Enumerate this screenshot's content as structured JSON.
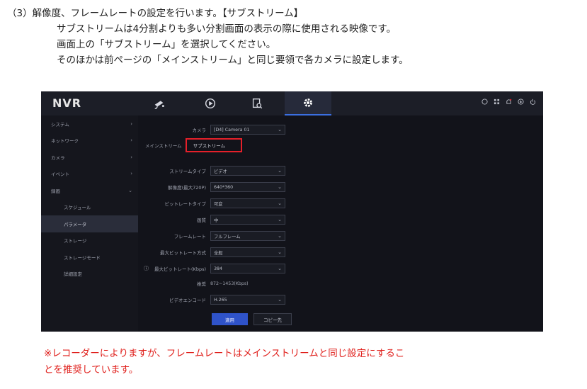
{
  "instructions": {
    "line1": "（3）解像度、フレームレートの設定を行います。【サブストリーム】",
    "line2": "サブストリームは4分割よりも多い分割画面の表示の際に使用される映像です。",
    "line3": "画面上の「サブストリーム」を選択してください。",
    "line4": "そのほかは前ページの「メインストリーム」と同じ要領で各カメラに設定します。"
  },
  "note": {
    "line1": "※レコーダーによりますが、フレームレートはメインストリームと同じ設定にするこ",
    "line2": "とを推奨しています。"
  },
  "nvr": {
    "logo": "NVR",
    "nav_icons": [
      "camera-icon",
      "playback-icon",
      "search-file-icon",
      "gear-icon"
    ],
    "status_icons": [
      "record-status-icon",
      "grid-icon",
      "alarm-icon",
      "download-icon",
      "power-icon"
    ],
    "sidebar": [
      {
        "label": "システム",
        "chevron": "›"
      },
      {
        "label": "ネットワーク",
        "chevron": "›"
      },
      {
        "label": "カメラ",
        "chevron": "›"
      },
      {
        "label": "イベント",
        "chevron": "›"
      },
      {
        "label": "録画",
        "chevron": "⌄"
      },
      {
        "label": "スケジュール",
        "chevron": ""
      },
      {
        "label": "パラメータ",
        "chevron": ""
      },
      {
        "label": "ストレージ",
        "chevron": ""
      },
      {
        "label": "ストレージモード",
        "chevron": ""
      },
      {
        "label": "詳細設定",
        "chevron": ""
      }
    ],
    "camera_label": "カメラ",
    "camera_value": "[D4] Camera 01",
    "tabs": [
      "メインストリーム",
      "サブストリーム"
    ],
    "fields": [
      {
        "label": "ストリームタイプ",
        "value": "ビデオ"
      },
      {
        "label": "解像度(最大720P)",
        "value": "640*360"
      },
      {
        "label": "ビットレートタイプ",
        "value": "可変"
      },
      {
        "label": "画質",
        "value": "中"
      },
      {
        "label": "フレームレート",
        "value": "フルフレーム"
      },
      {
        "label": "最大ビットレート方式",
        "value": "全般"
      },
      {
        "label": "最大ビットレート(Kbps)",
        "value": "384"
      }
    ],
    "recommend_label": "推奨",
    "recommend_value": "872~1453(Kbps)",
    "encode_label": "ビデオエンコード",
    "encode_value": "H.265",
    "apply_label": "適用",
    "copy_label": "コピー先"
  }
}
